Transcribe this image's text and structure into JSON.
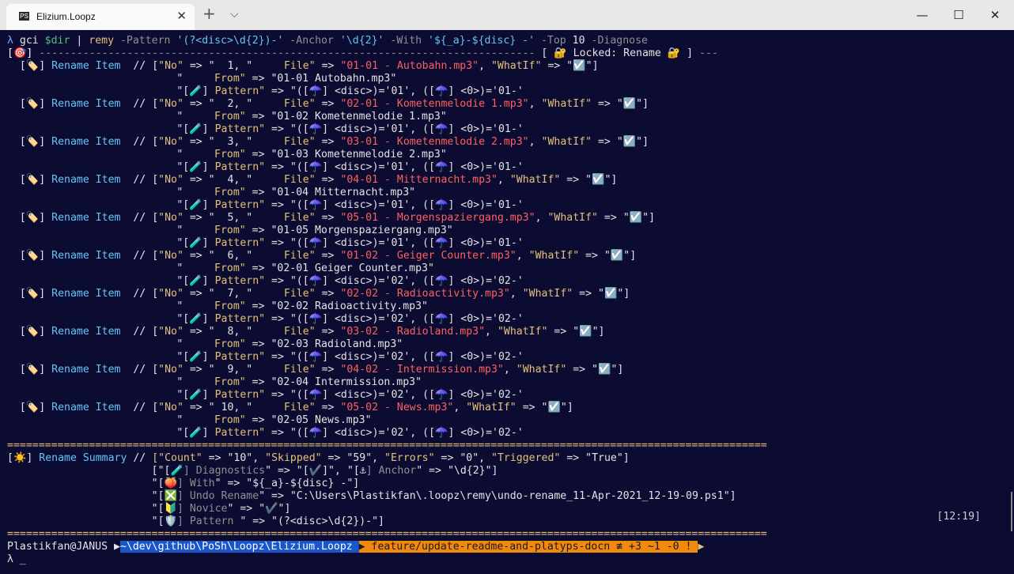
{
  "window": {
    "tab_title": "Elizium.Loopz",
    "tab_icon": "PS",
    "new_tab_glyph": "+",
    "dropdown_glyph": "⌵",
    "tab_close_glyph": "✕",
    "minimize_glyph": "—",
    "maximize_glyph": "☐",
    "close_glyph": "✕"
  },
  "prompt": {
    "symbol": "λ",
    "command": [
      {
        "t": "gci",
        "s": "w"
      },
      {
        "t": " ",
        "s": "w"
      },
      {
        "t": "$dir",
        "s": "gr"
      },
      {
        "t": " | ",
        "s": "w"
      },
      {
        "t": "remy",
        "s": "y"
      },
      {
        "t": " -Pattern ",
        "s": "g"
      },
      {
        "t": "'(?<disc>\\d{2})-'",
        "s": "c"
      },
      {
        "t": " -Anchor ",
        "s": "g"
      },
      {
        "t": "'\\d{2}'",
        "s": "c"
      },
      {
        "t": " -With ",
        "s": "g"
      },
      {
        "t": "'${_a}-${disc} -'",
        "s": "c"
      },
      {
        "t": " -Top ",
        "s": "g"
      },
      {
        "t": "10",
        "s": "w"
      },
      {
        "t": " -Diagnose",
        "s": "g"
      }
    ],
    "header_line": [
      {
        "t": "[🎯] ",
        "s": "wh"
      },
      {
        "t": "-------------------------------------------------------------------------------",
        "s": "g"
      },
      {
        "t": " [ 🔐 Locked: Rename 🔐 ]",
        "s": "w"
      },
      {
        "t": " ---",
        "s": "g"
      }
    ]
  },
  "rename_items": [
    {
      "no": "1",
      "file": "01-01 - Autobahn.mp3",
      "from": "01-01 Autobahn.mp3",
      "disc": "01",
      "group0": "01-"
    },
    {
      "no": "2",
      "file": "02-01 - Kometenmelodie 1.mp3",
      "from": "01-02 Kometenmelodie 1.mp3",
      "disc": "01",
      "group0": "01-"
    },
    {
      "no": "3",
      "file": "03-01 - Kometenmelodie 2.mp3",
      "from": "01-03 Kometenmelodie 2.mp3",
      "disc": "01",
      "group0": "01-"
    },
    {
      "no": "4",
      "file": "04-01 - Mitternacht.mp3",
      "from": "01-04 Mitternacht.mp3",
      "disc": "01",
      "group0": "01-"
    },
    {
      "no": "5",
      "file": "05-01 - Morgenspaziergang.mp3",
      "from": "01-05 Morgenspaziergang.mp3",
      "disc": "01",
      "group0": "01-"
    },
    {
      "no": "6",
      "file": "01-02 - Geiger Counter.mp3",
      "from": "02-01 Geiger Counter.mp3",
      "disc": "02",
      "group0": "02-"
    },
    {
      "no": "7",
      "file": "02-02 - Radioactivity.mp3",
      "from": "02-02 Radioactivity.mp3",
      "disc": "02",
      "group0": "02-"
    },
    {
      "no": "8",
      "file": "03-02 - Radioland.mp3",
      "from": "02-03 Radioland.mp3",
      "disc": "02",
      "group0": "02-"
    },
    {
      "no": "9",
      "file": "04-02 - Intermission.mp3",
      "from": "02-04 Intermission.mp3",
      "disc": "02",
      "group0": "02-"
    },
    {
      "no": "10",
      "file": "05-02 - News.mp3",
      "from": "02-05 News.mp3",
      "disc": "02",
      "group0": "02-"
    }
  ],
  "labels": {
    "item_icon": "🏷️",
    "item_title": "Rename Item",
    "no_key": "No",
    "file_key": "File",
    "from_key": "From",
    "whatif_key": "WhatIf",
    "whatif_value": "☑️",
    "pattern_icon": "🧪",
    "pattern_key": "Pattern",
    "umbrella": "☂️",
    "disc_group": "<disc>",
    "zero_group": "<0>"
  },
  "summary": {
    "separator_char": "=",
    "icon": "☀️",
    "title": "Rename Summary",
    "count": "10",
    "skipped": "59",
    "errors": "0",
    "triggered": "True",
    "rows": [
      [
        {
          "t": "[\"[",
          "s": "w"
        },
        {
          "t": "🧪",
          "s": "w"
        },
        {
          "t": "] Diagnostics",
          "s": "g"
        },
        {
          "t": "\" => ",
          "s": "w"
        },
        {
          "t": "\"[",
          "s": "w"
        },
        {
          "t": "✔️",
          "s": "grn"
        },
        {
          "t": "]\"",
          "s": "w"
        },
        {
          "t": ", ",
          "s": "w"
        },
        {
          "t": "\"[",
          "s": "w"
        },
        {
          "t": "⚓",
          "s": "w"
        },
        {
          "t": "] Anchor",
          "s": "g"
        },
        {
          "t": "\" => ",
          "s": "w"
        },
        {
          "t": "\"\\d{2}\"]",
          "s": "w"
        }
      ],
      [
        {
          "t": "\"[",
          "s": "w"
        },
        {
          "t": "🍑",
          "s": "w"
        },
        {
          "t": "] With",
          "s": "g"
        },
        {
          "t": "\" => ",
          "s": "w"
        },
        {
          "t": "\"${_a}-${disc} -\"]",
          "s": "w"
        }
      ],
      [
        {
          "t": "\"[",
          "s": "w"
        },
        {
          "t": "❎",
          "s": "grn"
        },
        {
          "t": "] Undo Rename",
          "s": "g"
        },
        {
          "t": "\" => ",
          "s": "w"
        },
        {
          "t": "\"C:\\Users\\Plastikfan\\.loopz\\remy\\undo-rename_11-Apr-2021_12-19-09.ps1\"]",
          "s": "w"
        }
      ],
      [
        {
          "t": "\"[",
          "s": "w"
        },
        {
          "t": "🔰",
          "s": "w"
        },
        {
          "t": "] Novice",
          "s": "g"
        },
        {
          "t": "\" => ",
          "s": "w"
        },
        {
          "t": "\"",
          "s": "w"
        },
        {
          "t": "✔️",
          "s": "grn"
        },
        {
          "t": "\"]",
          "s": "w"
        }
      ],
      [
        {
          "t": "\"[",
          "s": "w"
        },
        {
          "t": "🛡️",
          "s": "w"
        },
        {
          "t": "] Pattern ",
          "s": "g"
        },
        {
          "t": "\" => ",
          "s": "w"
        },
        {
          "t": "\"(?<disc>\\d{2})-\"]",
          "s": "w"
        }
      ]
    ]
  },
  "status": {
    "user": "Plastikfan@JANUS",
    "path": "~\\dev\\github\\PoSh\\Loopz\\Elizium.Loopz",
    "branch": " feature/update-readme-and-platyps-docn ≢ +3 ~1 -0 ! ",
    "time": "[12:19]",
    "cursor": "λ _"
  },
  "colors": {
    "background": "#0c0c32",
    "filename_red": "#ff5f5f",
    "path_blue": "#1a55c9",
    "branch_orange": "#f08a0d"
  }
}
